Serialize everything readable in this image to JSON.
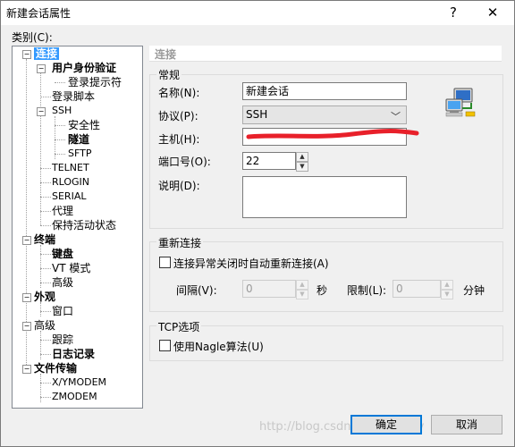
{
  "window": {
    "title": "新建会话属性",
    "help_label": "?",
    "close_label": "✕"
  },
  "category_label": "类别(C):",
  "tree": {
    "items": [
      {
        "label": "连接"
      },
      {
        "label": "用户身份验证"
      },
      {
        "label": "登录提示符"
      },
      {
        "label": "登录脚本"
      },
      {
        "label": "SSH"
      },
      {
        "label": "安全性"
      },
      {
        "label": "隧道"
      },
      {
        "label": "SFTP"
      },
      {
        "label": "TELNET"
      },
      {
        "label": "RLOGIN"
      },
      {
        "label": "SERIAL"
      },
      {
        "label": "代理"
      },
      {
        "label": "保持活动状态"
      },
      {
        "label": "终端"
      },
      {
        "label": "键盘"
      },
      {
        "label": "VT 模式"
      },
      {
        "label": "高级"
      },
      {
        "label": "外观"
      },
      {
        "label": "窗口"
      },
      {
        "label": "高级"
      },
      {
        "label": "跟踪"
      },
      {
        "label": "日志记录"
      },
      {
        "label": "文件传输"
      },
      {
        "label": "X/YMODEM"
      },
      {
        "label": "ZMODEM"
      }
    ]
  },
  "panel": {
    "header": "连接",
    "general": {
      "title": "常规",
      "name_label": "名称(N):",
      "name_value": "新建会话",
      "protocol_label": "协议(P):",
      "protocol_value": "SSH",
      "host_label": "主机(H):",
      "host_value": "",
      "port_label": "端口号(O):",
      "port_value": "22",
      "desc_label": "说明(D):",
      "desc_value": ""
    },
    "reconnect": {
      "title": "重新连接",
      "auto_label": "连接异常关闭时自动重新连接(A)",
      "interval_label": "间隔(V):",
      "interval_value": "0",
      "seconds_unit": "秒",
      "limit_label": "限制(L):",
      "limit_value": "0",
      "minutes_unit": "分钟"
    },
    "tcp": {
      "title": "TCP选项",
      "nagle_label": "使用Nagle算法(U)"
    }
  },
  "buttons": {
    "ok": "确定",
    "cancel": "取消"
  },
  "watermark": "http://blog.csdn.net/WH_Sky",
  "colors": {
    "selection": "#3399ff",
    "redaction": "#e8202a"
  }
}
